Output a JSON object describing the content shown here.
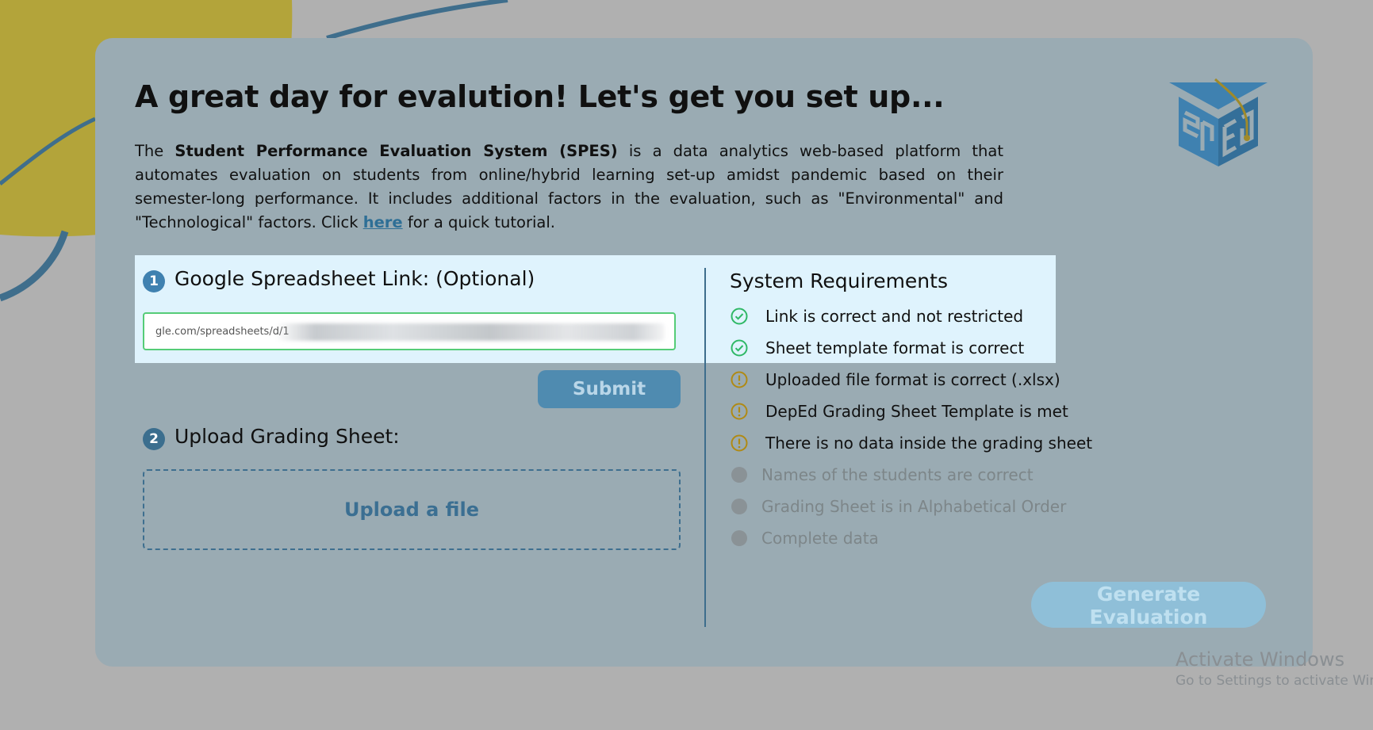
{
  "page": {
    "title": "A great day for evalution! Let's get you set up...",
    "intro": {
      "prefix": "The ",
      "system_name": "Student Performance Evaluation System (SPES)",
      "body": " is a data analytics web-based platform that automates evaluation on students from online/hybrid learning set-up amidst pandemic based on their semester-long performance. It includes additional factors in the evaluation, such as \"Environmental\" and \"Technological\" factors. Click ",
      "link": "here",
      "suffix": " for a quick tutorial."
    },
    "logo_icon": "spes-graduation-cap-logo"
  },
  "step1": {
    "number": "1",
    "label": "Google Spreadsheet Link: (Optional)",
    "input_value": "gle.com/spreadsheets/d/1",
    "submit_label": "Submit"
  },
  "step2": {
    "number": "2",
    "label": "Upload Grading Sheet:",
    "upload_label": "Upload a file"
  },
  "requirements": {
    "title": "System Requirements",
    "items": [
      {
        "label": "Link is correct and not restricted",
        "status": "ok",
        "icon": "check-circle-icon"
      },
      {
        "label": "Sheet template format is correct",
        "status": "ok",
        "icon": "check-circle-icon"
      },
      {
        "label": "Uploaded file format is correct (.xlsx)",
        "status": "warn",
        "icon": "exclamation-circle-icon"
      },
      {
        "label": "DepEd Grading Sheet Template is met",
        "status": "warn",
        "icon": "exclamation-circle-icon"
      },
      {
        "label": "There is no data inside the grading sheet",
        "status": "warn",
        "icon": "exclamation-circle-icon"
      },
      {
        "label": "Names of the students are correct",
        "status": "pending",
        "icon": "gray-dot-icon"
      },
      {
        "label": "Grading Sheet is in Alphabetical Order",
        "status": "pending",
        "icon": "gray-dot-icon"
      },
      {
        "label": "Complete data",
        "status": "pending",
        "icon": "gray-dot-icon"
      }
    ]
  },
  "generate_label": "Generate Evaluation",
  "watermark": {
    "title": "Activate Windows",
    "subtitle": "Go to Settings to activate Wind"
  },
  "colors": {
    "card_bg": "#9aabb3",
    "highlight_bg": "#dff3fd",
    "accent_blue": "#3f81b0",
    "ok_green": "#2fb866",
    "warn_amber": "#b08a14",
    "deco_yellow": "#b3a43a"
  }
}
